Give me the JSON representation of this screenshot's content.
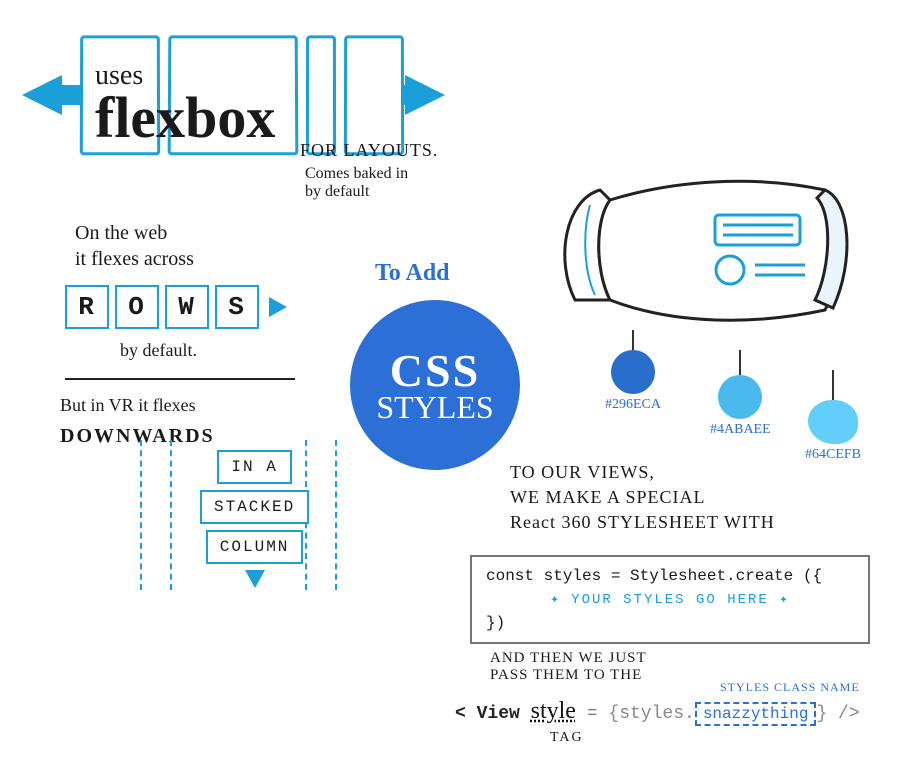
{
  "flexbox": {
    "uses": "uses",
    "title": "flexbox",
    "for_layouts": "FOR LAYOUTS.",
    "baked_in": "Comes baked in\nby default"
  },
  "rows_section": {
    "intro": "On the web\nit flexes across",
    "letters": [
      "R",
      "O",
      "W",
      "S"
    ],
    "by_default": "by default.",
    "vr_intro": "But in VR it flexes",
    "downwards": "DOWNWARDS",
    "column_words": [
      "IN A",
      "STACKED",
      "COLUMN"
    ]
  },
  "center": {
    "to_add": "To Add",
    "css": "CSS",
    "styles": "STYLES"
  },
  "palette": {
    "swatches": [
      {
        "hex": "#296ECA"
      },
      {
        "hex": "#4ABAEE"
      },
      {
        "hex": "#64CEFB"
      }
    ]
  },
  "views": {
    "line1": "TO OUR VIEWS,",
    "line2": "WE MAKE A SPECIAL",
    "line3": "React 360 STYLESHEET WITH"
  },
  "code": {
    "open": "const styles = Stylesheet.create ({",
    "placeholder": "YOUR STYLES GO HERE",
    "close": "})"
  },
  "pass": {
    "line1": "and THEN WE JUST",
    "line2": "PASS THEM TO THE",
    "class_label": "STYLES CLASS NAME",
    "view_open": "< View",
    "style_word": "style",
    "equals": "=",
    "expr_open": "{styles.",
    "snazzy": "snazzything",
    "expr_close": "} />",
    "tag_label": "TAG"
  }
}
